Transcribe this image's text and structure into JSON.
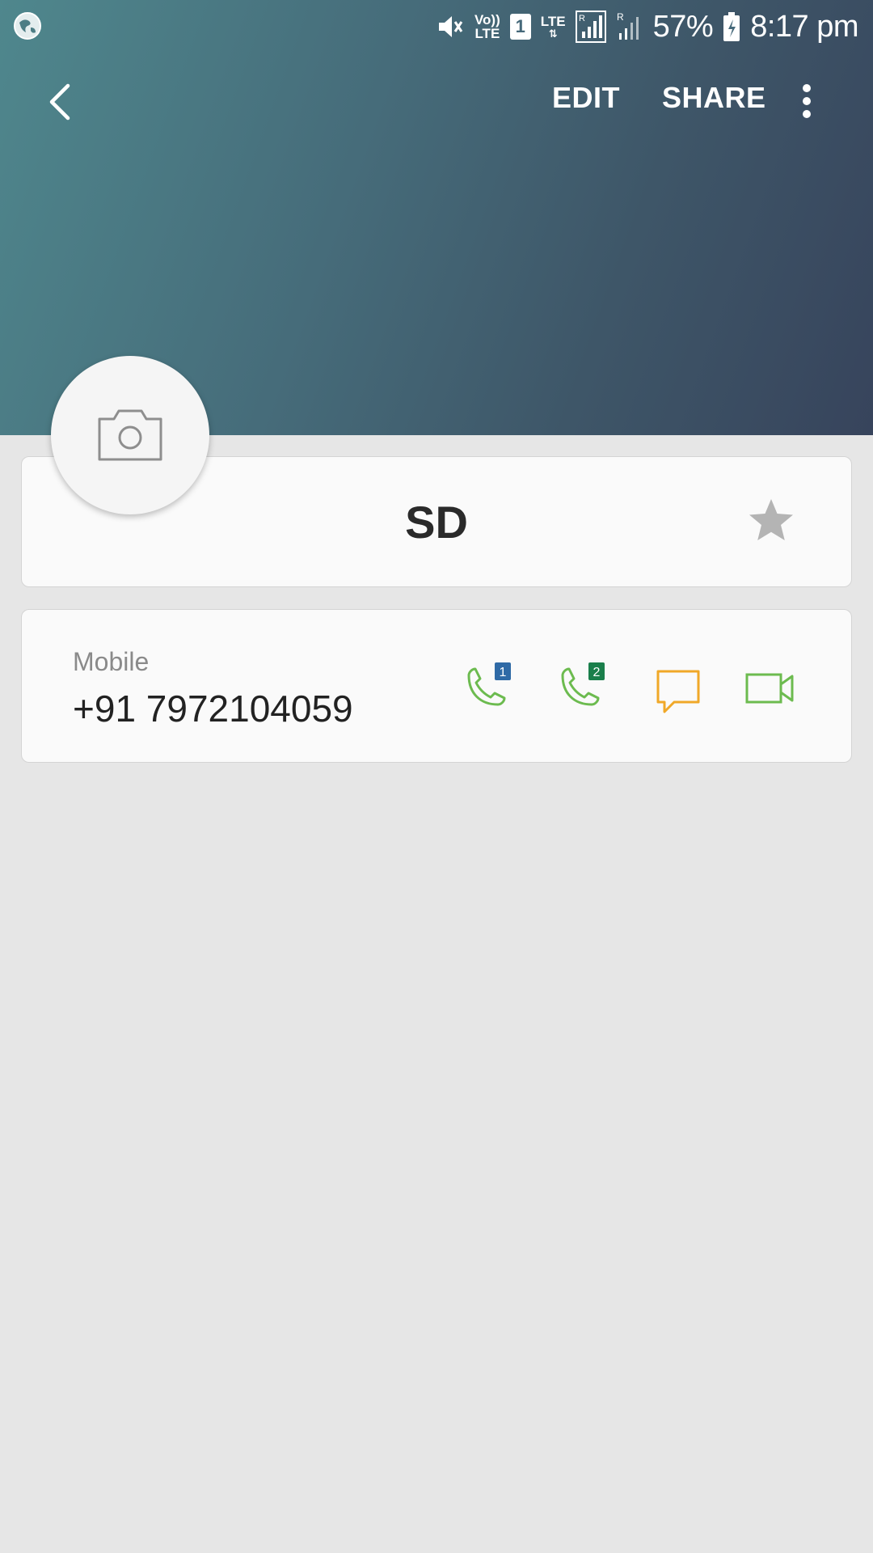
{
  "status_bar": {
    "battery_percent": "57%",
    "time": "8:17 pm",
    "volte_label_top": "Vo))",
    "volte_label_bottom": "LTE",
    "sim_slot": "1",
    "lte_label": "LTE",
    "roaming_label": "R",
    "icons": [
      "globe-icon",
      "mute-icon",
      "volte-icon",
      "sim-icon",
      "lte-icon",
      "signal-icon",
      "signal-icon",
      "battery-charging-icon"
    ]
  },
  "toolbar": {
    "back_icon": "chevron-left-icon",
    "edit_label": "EDIT",
    "share_label": "SHARE",
    "more_icon": "more-vertical-icon"
  },
  "contact": {
    "avatar_icon": "camera-icon",
    "name": "SD",
    "favorite_icon": "star-icon"
  },
  "phone": {
    "type_label": "Mobile",
    "number": "+91 7972104059",
    "sim1_badge": "1",
    "sim2_badge": "2",
    "actions": [
      "phone-sim1-icon",
      "phone-sim2-icon",
      "message-icon",
      "video-call-icon"
    ]
  },
  "colors": {
    "header_gradient_start": "#4f878d",
    "header_gradient_end": "#37445c",
    "call_green": "#6cbb4f",
    "sim1_blue": "#2f6aa6",
    "sim2_green": "#1a7f4b",
    "message_orange": "#f0a828",
    "video_green": "#6cbb4f",
    "star_gray": "#b4b4b4",
    "background": "#e6e6e6"
  }
}
